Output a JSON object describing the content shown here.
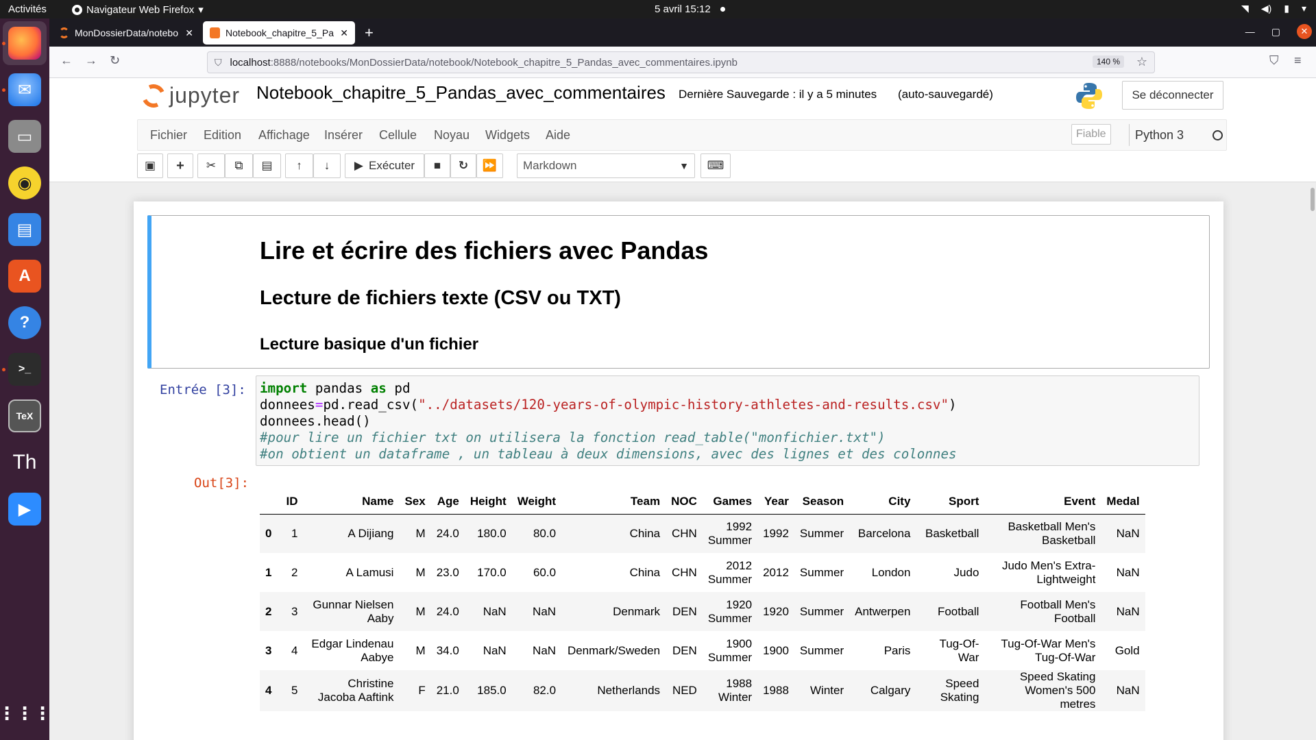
{
  "system": {
    "activities": "Activités",
    "app_menu": "Navigateur Web Firefox",
    "clock": "5 avril  15:12"
  },
  "browser": {
    "tabs": [
      {
        "label": "MonDossierData/notebo",
        "active": false
      },
      {
        "label": "Notebook_chapitre_5_Pa",
        "active": true
      }
    ],
    "url_host": "localhost",
    "url_rest": ":8888/notebooks/MonDossierData/notebook/Notebook_chapitre_5_Pandas_avec_commentaires.ipynb",
    "zoom": "140 %"
  },
  "jupyter": {
    "logo_text": "jupyter",
    "notebook_title": "Notebook_chapitre_5_Pandas_avec_commentaires",
    "save_status": "Dernière Sauvegarde : il y a 5 minutes",
    "autosave": "(auto-sauvegardé)",
    "logout_label": "Se déconnecter",
    "menu": [
      "Fichier",
      "Edition",
      "Affichage",
      "Insérer",
      "Cellule",
      "Noyau",
      "Widgets",
      "Aide"
    ],
    "trusted": "Fiable",
    "kernel": "Python 3",
    "run_label": "Exécuter",
    "cell_type": "Markdown"
  },
  "markdown_cell": {
    "h1": "Lire et écrire des fichiers avec Pandas",
    "h2": "Lecture de fichiers texte (CSV ou TXT)",
    "h3": "Lecture basique d'un fichier"
  },
  "code_cell": {
    "prompt_in": "Entrée [3]:",
    "prompt_out": "Out[3]:",
    "line1_kw1": "import",
    "line1_mid": " pandas ",
    "line1_kw2": "as",
    "line1_end": " pd",
    "line2_start": "donnees",
    "line2_op": "=",
    "line2_mid": "pd.read_csv(",
    "line2_str": "\"../datasets/120-years-of-olympic-history-athletes-and-results.csv\"",
    "line2_end": ")",
    "line3": "donnees.head()",
    "line4": "#pour lire un fichier txt on utilisera la fonction read_table(\"monfichier.txt\")",
    "line5": "#on obtient un dataframe , un tableau à deux dimensions, avec des lignes et des colonnes"
  },
  "dataframe": {
    "columns": [
      "",
      "ID",
      "Name",
      "Sex",
      "Age",
      "Height",
      "Weight",
      "Team",
      "NOC",
      "Games",
      "Year",
      "Season",
      "City",
      "Sport",
      "Event",
      "Medal"
    ],
    "rows": [
      [
        "0",
        "1",
        "A Dijiang",
        "M",
        "24.0",
        "180.0",
        "80.0",
        "China",
        "CHN",
        "1992 Summer",
        "1992",
        "Summer",
        "Barcelona",
        "Basketball",
        "Basketball Men's Basketball",
        "NaN"
      ],
      [
        "1",
        "2",
        "A Lamusi",
        "M",
        "23.0",
        "170.0",
        "60.0",
        "China",
        "CHN",
        "2012 Summer",
        "2012",
        "Summer",
        "London",
        "Judo",
        "Judo Men's Extra-Lightweight",
        "NaN"
      ],
      [
        "2",
        "3",
        "Gunnar Nielsen Aaby",
        "M",
        "24.0",
        "NaN",
        "NaN",
        "Denmark",
        "DEN",
        "1920 Summer",
        "1920",
        "Summer",
        "Antwerpen",
        "Football",
        "Football Men's Football",
        "NaN"
      ],
      [
        "3",
        "4",
        "Edgar Lindenau Aabye",
        "M",
        "34.0",
        "NaN",
        "NaN",
        "Denmark/Sweden",
        "DEN",
        "1900 Summer",
        "1900",
        "Summer",
        "Paris",
        "Tug-Of-War",
        "Tug-Of-War Men's Tug-Of-War",
        "Gold"
      ],
      [
        "4",
        "5",
        "Christine Jacoba Aaftink",
        "F",
        "21.0",
        "185.0",
        "82.0",
        "Netherlands",
        "NED",
        "1988 Winter",
        "1988",
        "Winter",
        "Calgary",
        "Speed Skating",
        "Speed Skating Women's 500 metres",
        "NaN"
      ]
    ]
  },
  "colors": {
    "accent_blue": "#42a5f5",
    "prompt_in": "#303f9f",
    "prompt_out": "#d84315",
    "ubuntu_orange": "#e95420"
  }
}
